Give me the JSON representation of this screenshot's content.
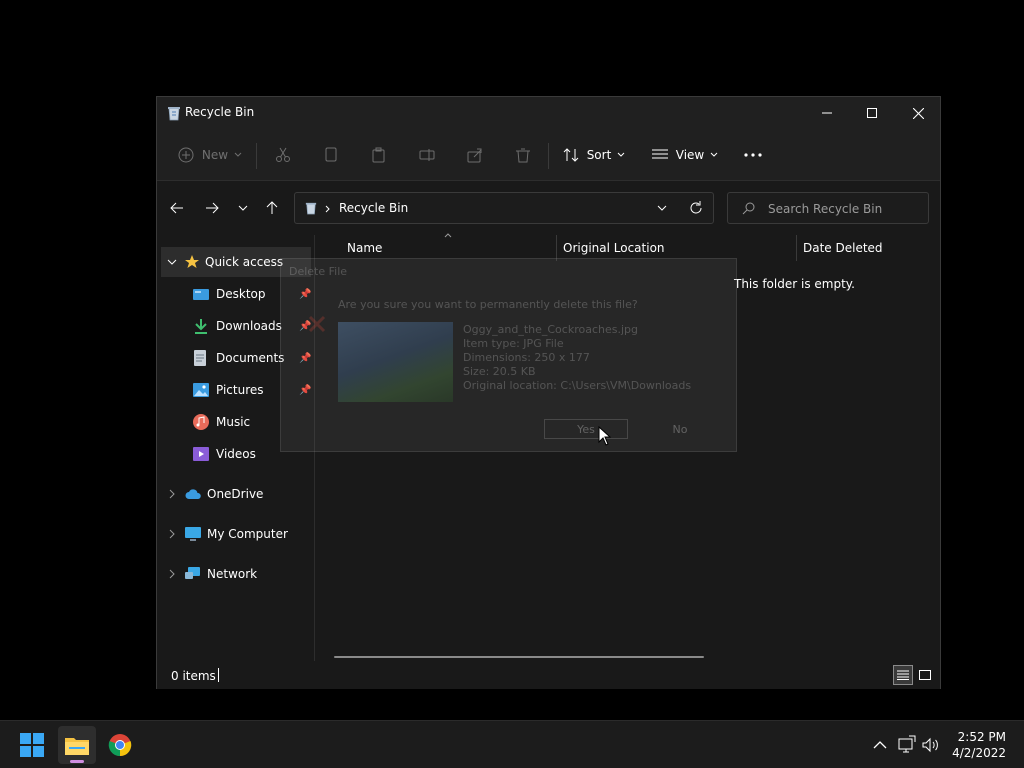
{
  "window": {
    "title": "Recycle Bin"
  },
  "toolbar": {
    "new_label": "New",
    "sort_label": "Sort",
    "view_label": "View"
  },
  "address": {
    "crumb": "Recycle Bin"
  },
  "search": {
    "placeholder": "Search Recycle Bin"
  },
  "nav": {
    "quick_access": "Quick access",
    "items": [
      "Desktop",
      "Downloads",
      "Documents",
      "Pictures",
      "Music",
      "Videos"
    ],
    "onedrive": "OneDrive",
    "my_computer": "My Computer",
    "network": "Network"
  },
  "columns": {
    "name": "Name",
    "original_location": "Original Location",
    "date_deleted": "Date Deleted"
  },
  "empty_message": "This folder is empty.",
  "status": {
    "items": "0 items"
  },
  "dialog": {
    "title": "Delete File",
    "question": "Are you sure you want to permanently delete this file?",
    "file_name": "Oggy_and_the_Cockroaches.jpg",
    "item_type": "Item type: JPG File",
    "dimensions": "Dimensions: 250 x 177",
    "size": "Size: 20.5 KB",
    "original_location": "Original location: C:\\Users\\VM\\Downloads",
    "yes": "Yes",
    "no": "No"
  },
  "taskbar": {
    "time": "2:52 PM",
    "date": "4/2/2022"
  },
  "colors": {
    "accent": "#0078d4",
    "folder": "#f5c242"
  }
}
